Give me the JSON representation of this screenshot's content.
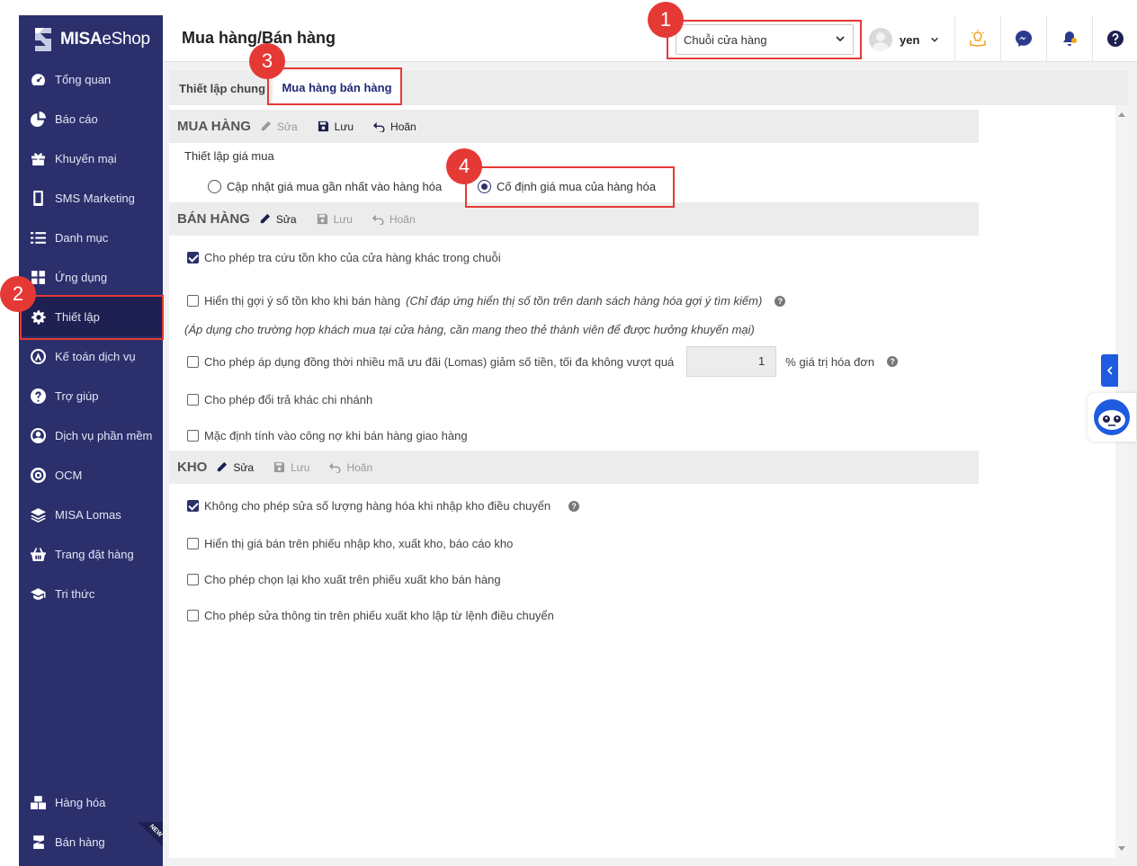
{
  "app": {
    "logo_brand": "MISA",
    "logo_product": "eShop"
  },
  "sidebar": {
    "items": [
      {
        "label": "Tổng quan",
        "icon": "dashboard-icon"
      },
      {
        "label": "Báo cáo",
        "icon": "pie-chart-icon"
      },
      {
        "label": "Khuyến mại",
        "icon": "gift-icon"
      },
      {
        "label": "SMS Marketing",
        "icon": "phone-icon"
      },
      {
        "label": "Danh mục",
        "icon": "list-icon"
      },
      {
        "label": "Ứng dụng",
        "icon": "apps-icon"
      },
      {
        "label": "Thiết lập",
        "icon": "gear-icon",
        "active": true
      },
      {
        "label": "Kế toán dịch vụ",
        "icon": "accounting-icon"
      },
      {
        "label": "Trợ giúp",
        "icon": "help-icon"
      },
      {
        "label": "Dịch vụ phần mềm",
        "icon": "user-circle-icon"
      },
      {
        "label": "OCM",
        "icon": "ocm-icon"
      },
      {
        "label": "MISA Lomas",
        "icon": "layers-icon"
      },
      {
        "label": "Trang đặt hàng",
        "icon": "basket-icon"
      },
      {
        "label": "Tri thức",
        "icon": "graduation-cap-icon"
      }
    ],
    "bottom_items": [
      {
        "label": "Hàng hóa",
        "icon": "boxes-icon"
      },
      {
        "label": "Bán hàng",
        "icon": "sales-icon",
        "badge": "NEW"
      }
    ]
  },
  "header": {
    "title": "Mua hàng/Bán hàng",
    "store_select_value": "Chuỗi cửa hàng",
    "user_name": "yen"
  },
  "tabs": [
    {
      "label": "Thiết lập chung"
    },
    {
      "label": "Mua hàng bán hàng",
      "active": true
    }
  ],
  "sections": {
    "purchase": {
      "title": "MUA HÀNG",
      "edit": "Sửa",
      "save": "Lưu",
      "undo": "Hoãn",
      "price_setting_label": "Thiết lập giá mua",
      "option_update": "Cập nhật giá mua gần nhất vào hàng hóa",
      "option_fixed": "Cố định giá mua của hàng hóa",
      "selected": "fixed"
    },
    "sales": {
      "title": "BÁN HÀNG",
      "edit": "Sửa",
      "save": "Lưu",
      "undo": "Hoãn",
      "opt1": "Cho phép tra cứu tồn kho của cửa hàng khác trong chuỗi",
      "opt2": "Hiển thị gợi ý số tồn kho khi bán hàng",
      "opt2_note": "(Chỉ đáp ứng hiển thị số tồn trên danh sách hàng hóa gợi ý tìm kiếm)",
      "note_line": "(Áp dụng cho trường hợp khách mua tại cửa hàng, cần mang theo thẻ thành viên để được hưởng khuyến mại)",
      "opt3": "Cho phép áp dụng đồng thời nhiều mã ưu đãi (Lomas) giảm số tiền, tối đa không vượt quá",
      "opt3_value": "1",
      "opt3_suffix": "% giá trị hóa đơn",
      "opt4": "Cho phép đổi trả khác chi nhánh",
      "opt5": "Mặc định tính vào công nợ khi bán hàng giao hàng",
      "checked": [
        true,
        false,
        false,
        false,
        false
      ]
    },
    "warehouse": {
      "title": "KHO",
      "edit": "Sửa",
      "save": "Lưu",
      "undo": "Hoãn",
      "opt1": "Không cho phép sửa số lượng hàng hóa khi nhập kho điều chuyển",
      "opt2": "Hiển thị giá bán trên phiếu nhập kho, xuất kho, báo cáo kho",
      "opt3": "Cho phép chọn lại kho xuất trên phiếu xuất kho bán hàng",
      "opt4": "Cho phép sửa thông tin trên phiếu xuất kho lập từ lệnh điều chuyển",
      "checked": [
        true,
        false,
        false,
        false
      ]
    }
  },
  "callouts": [
    "1",
    "2",
    "3",
    "4"
  ],
  "colors": {
    "sidebar_bg": "#2b2f6b",
    "accent": "#2b2f6b",
    "callout": "#e53935"
  }
}
